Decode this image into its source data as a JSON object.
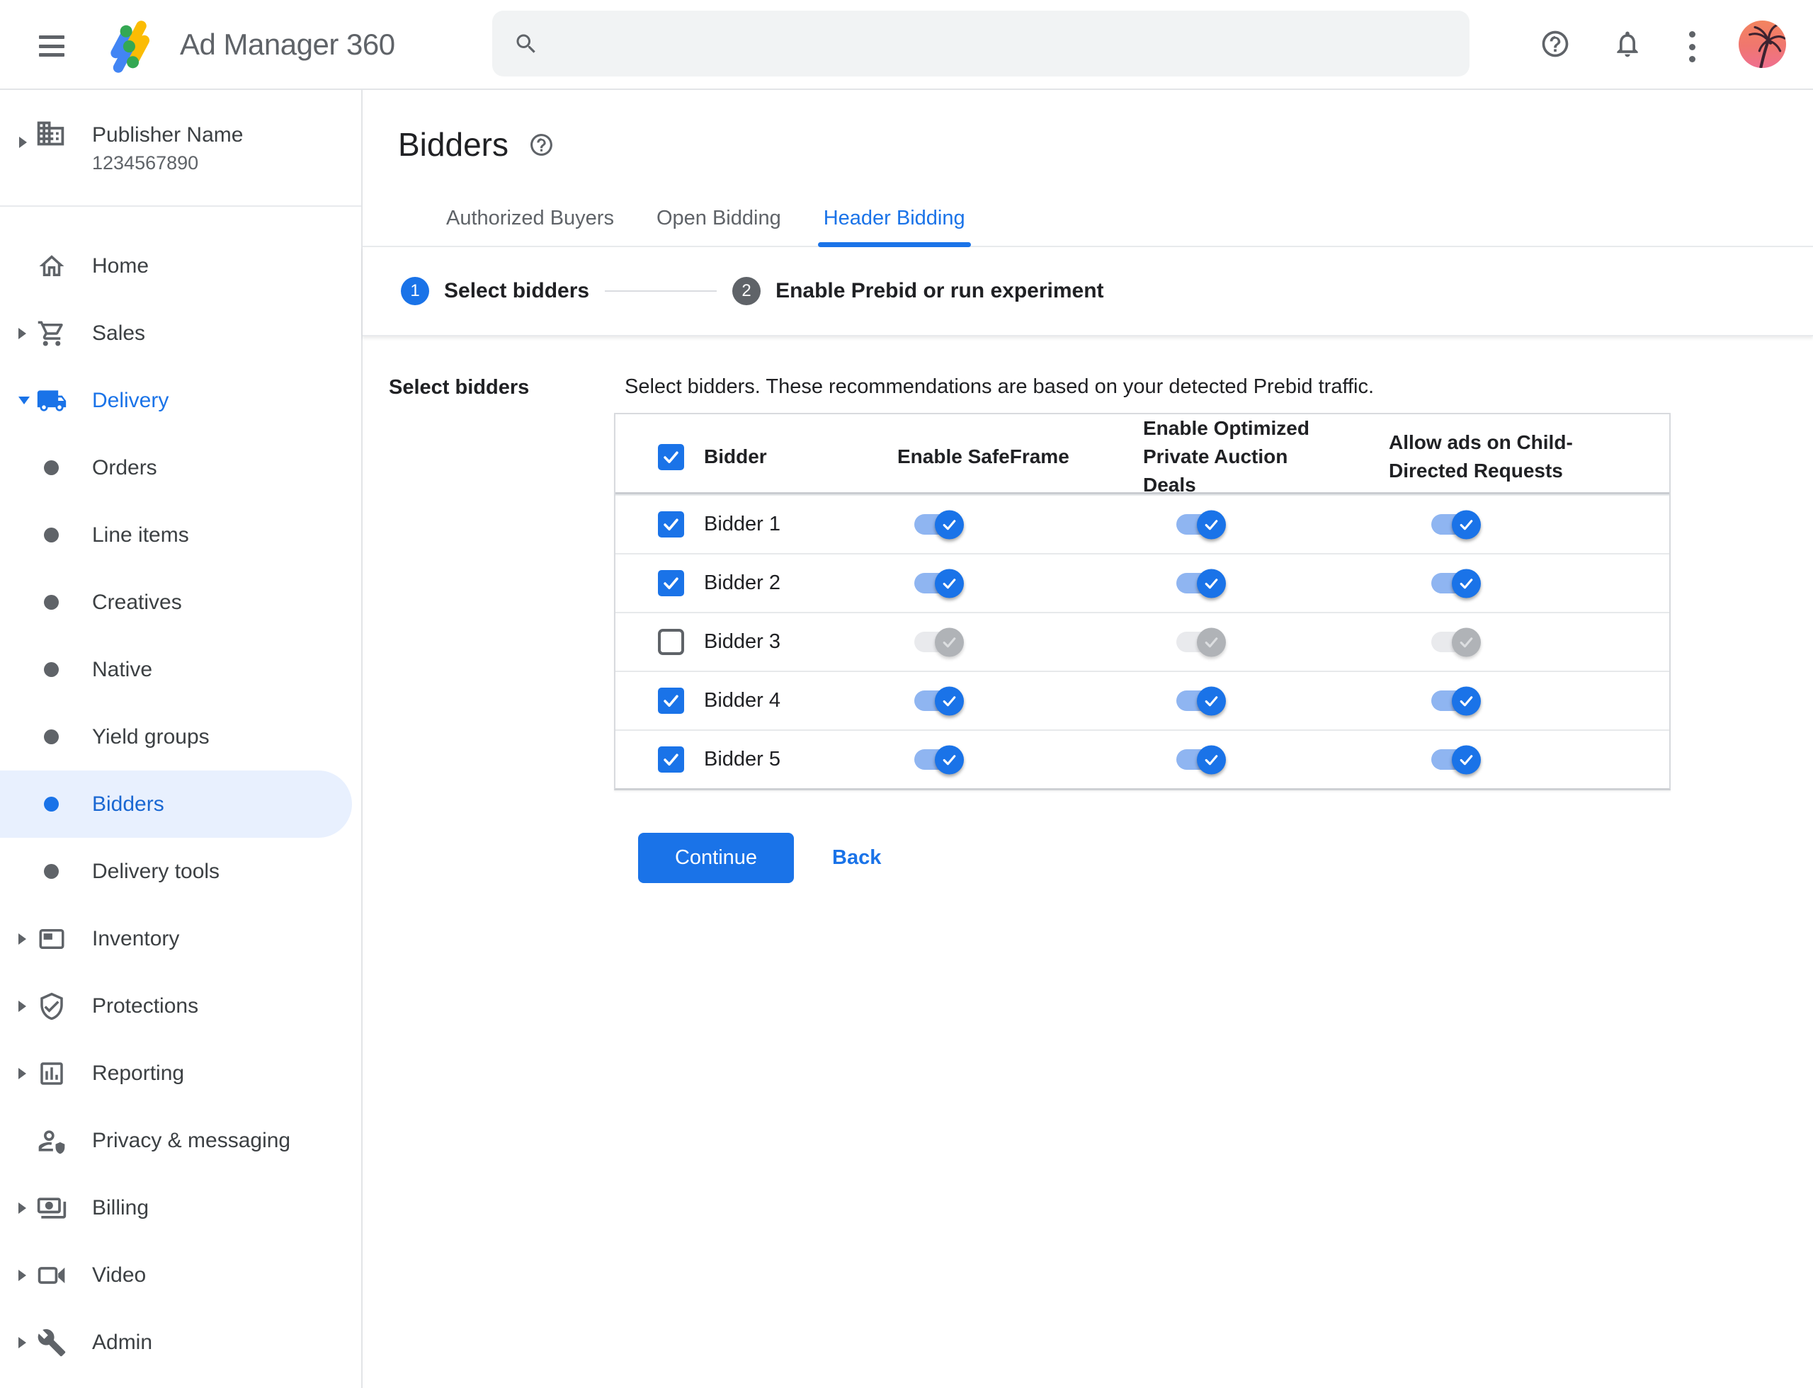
{
  "colors": {
    "primary_blue": "#1a73e8",
    "selected_nav_bg": "#e8f0fe",
    "selected_nav_text": "#1967d2",
    "toggle_on_track": "#8fb5f1",
    "toggle_off_track": "#e9eaed",
    "toggle_off_thumb": "#b0b3b7",
    "search_bg": "#f1f3f4",
    "text_primary": "#202124",
    "text_secondary": "#5f6368",
    "border": "#dadce0"
  },
  "icons": {
    "menu": "hamburger",
    "logo": "ad-manager-diagonal-bars",
    "search": "magnifier",
    "help": "question-mark-circle",
    "notifications": "bell",
    "more": "kebab-dots",
    "avatar": "palm-tree-sunset-photo",
    "publisher": "building",
    "home": "house",
    "sales": "shopping-cart",
    "delivery": "truck",
    "inventory": "web-frame",
    "protections": "shield-check",
    "reporting": "bar-chart",
    "privacy": "person-shield",
    "billing": "money-bill",
    "video": "video-camera",
    "admin": "wrench"
  },
  "topbar": {
    "app_title": "Ad Manager 360",
    "search_placeholder": ""
  },
  "sidebar": {
    "publisher": {
      "name": "Publisher Name",
      "id": "1234567890"
    },
    "items": [
      {
        "label": "Home"
      },
      {
        "label": "Sales"
      },
      {
        "label": "Delivery",
        "children": [
          {
            "label": "Orders"
          },
          {
            "label": "Line items"
          },
          {
            "label": "Creatives"
          },
          {
            "label": "Native"
          },
          {
            "label": "Yield groups"
          },
          {
            "label": "Bidders",
            "selected": true
          },
          {
            "label": "Delivery tools"
          }
        ]
      },
      {
        "label": "Inventory"
      },
      {
        "label": "Protections"
      },
      {
        "label": "Reporting"
      },
      {
        "label": "Privacy & messaging"
      },
      {
        "label": "Billing"
      },
      {
        "label": "Video"
      },
      {
        "label": "Admin"
      }
    ]
  },
  "main": {
    "page_title": "Bidders",
    "tabs": [
      {
        "label": "Authorized Buyers",
        "active": false
      },
      {
        "label": "Open Bidding",
        "active": false
      },
      {
        "label": "Header Bidding",
        "active": true
      }
    ],
    "stepper": [
      {
        "number": "1",
        "label": "Select bidders",
        "state": "active"
      },
      {
        "number": "2",
        "label": "Enable Prebid or run experiment",
        "state": "inactive"
      }
    ],
    "section_label": "Select bidders",
    "description": "Select bidders. These recommendations are based on your detected Prebid traffic.",
    "table": {
      "header_checkbox_checked": true,
      "columns": [
        "Bidder",
        "Enable SafeFrame",
        "Enable Optimized Private Auction Deals",
        "Allow ads on Child-Directed Requests"
      ],
      "rows": [
        {
          "name": "Bidder 1",
          "checked": true,
          "enable_safeframe": true,
          "enable_optimized_deals": true,
          "allow_child_directed": true
        },
        {
          "name": "Bidder 2",
          "checked": true,
          "enable_safeframe": true,
          "enable_optimized_deals": true,
          "allow_child_directed": true
        },
        {
          "name": "Bidder 3",
          "checked": false,
          "enable_safeframe": false,
          "enable_optimized_deals": false,
          "allow_child_directed": false
        },
        {
          "name": "Bidder 4",
          "checked": true,
          "enable_safeframe": true,
          "enable_optimized_deals": true,
          "allow_child_directed": true
        },
        {
          "name": "Bidder 5",
          "checked": true,
          "enable_safeframe": true,
          "enable_optimized_deals": true,
          "allow_child_directed": true
        }
      ]
    },
    "actions": {
      "continue": "Continue",
      "back": "Back"
    }
  }
}
